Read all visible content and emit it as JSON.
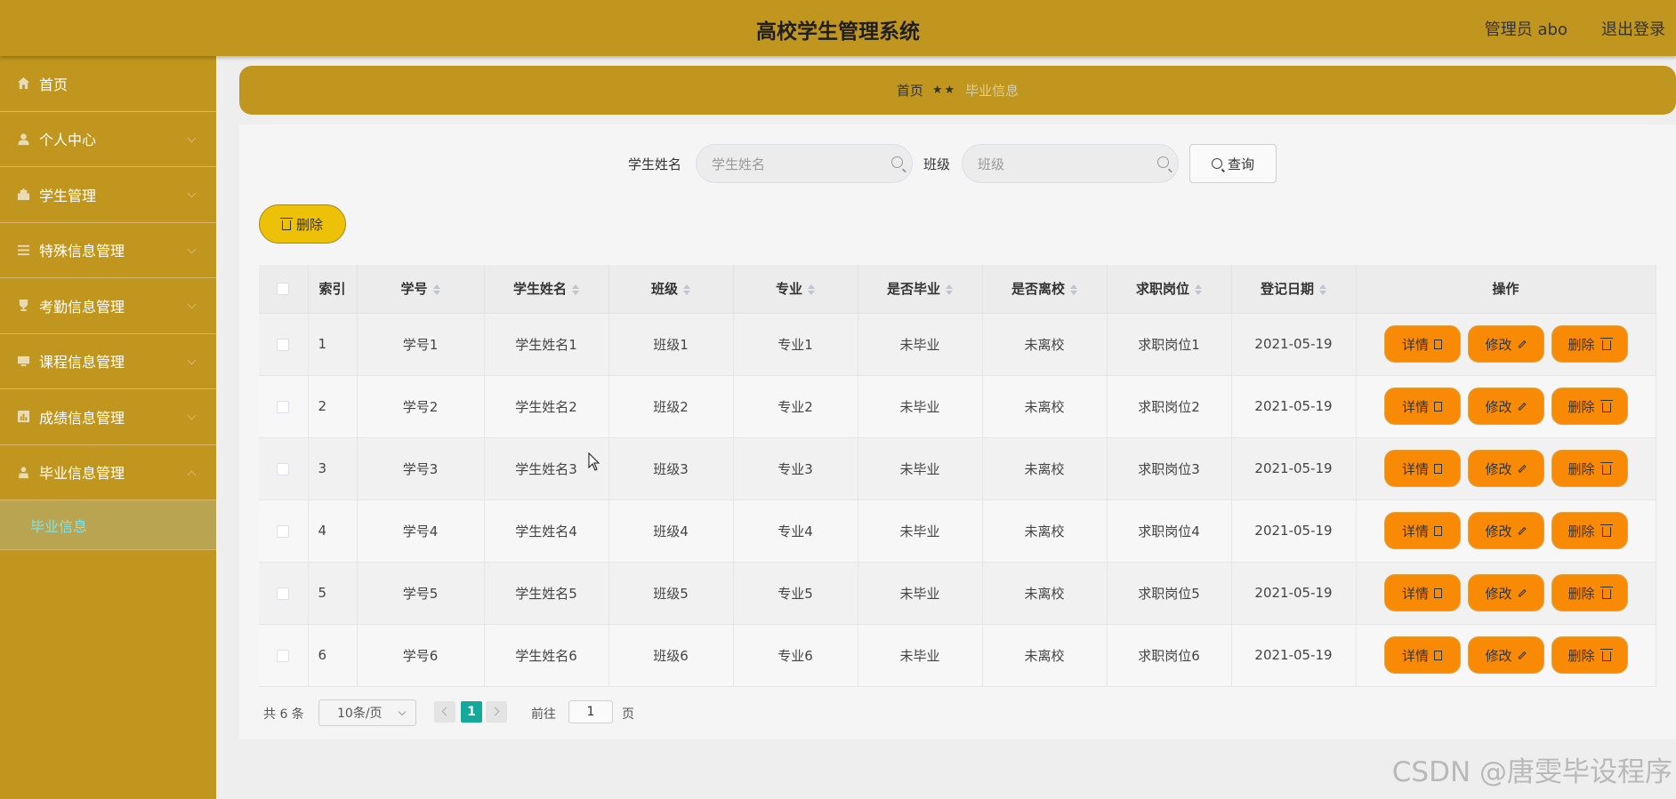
{
  "header": {
    "title": "高校学生管理系统",
    "admin": "管理员 abo",
    "logout": "退出登录"
  },
  "sidebar": {
    "items": [
      {
        "label": "首页",
        "icon": "home-icon",
        "has_arrow": false
      },
      {
        "label": "个人中心",
        "icon": "user-icon",
        "has_arrow": true
      },
      {
        "label": "学生管理",
        "icon": "student-icon",
        "has_arrow": true
      },
      {
        "label": "特殊信息管理",
        "icon": "list-icon",
        "has_arrow": true
      },
      {
        "label": "考勤信息管理",
        "icon": "trophy-icon",
        "has_arrow": true
      },
      {
        "label": "课程信息管理",
        "icon": "monitor-icon",
        "has_arrow": true
      },
      {
        "label": "成绩信息管理",
        "icon": "chart-icon",
        "has_arrow": true
      },
      {
        "label": "毕业信息管理",
        "icon": "person-icon",
        "has_arrow": true
      }
    ],
    "subitem": "毕业信息"
  },
  "breadcrumb": {
    "home": "首页",
    "separator": "★★",
    "current": "毕业信息"
  },
  "search": {
    "name_label": "学生姓名",
    "name_placeholder": "学生姓名",
    "class_label": "班级",
    "class_placeholder": "班级",
    "query_button": "查询"
  },
  "delete_button": "删除",
  "table": {
    "headers": [
      "索引",
      "学号",
      "学生姓名",
      "班级",
      "专业",
      "是否毕业",
      "是否离校",
      "求职岗位",
      "登记日期",
      "操作"
    ],
    "rows": [
      {
        "index": "1",
        "student_no": "学号1",
        "name": "学生姓名1",
        "class": "班级1",
        "major": "专业1",
        "graduated": "未毕业",
        "left_school": "未离校",
        "job": "求职岗位1",
        "date": "2021-05-19"
      },
      {
        "index": "2",
        "student_no": "学号2",
        "name": "学生姓名2",
        "class": "班级2",
        "major": "专业2",
        "graduated": "未毕业",
        "left_school": "未离校",
        "job": "求职岗位2",
        "date": "2021-05-19"
      },
      {
        "index": "3",
        "student_no": "学号3",
        "name": "学生姓名3",
        "class": "班级3",
        "major": "专业3",
        "graduated": "未毕业",
        "left_school": "未离校",
        "job": "求职岗位3",
        "date": "2021-05-19"
      },
      {
        "index": "4",
        "student_no": "学号4",
        "name": "学生姓名4",
        "class": "班级4",
        "major": "专业4",
        "graduated": "未毕业",
        "left_school": "未离校",
        "job": "求职岗位4",
        "date": "2021-05-19"
      },
      {
        "index": "5",
        "student_no": "学号5",
        "name": "学生姓名5",
        "class": "班级5",
        "major": "专业5",
        "graduated": "未毕业",
        "left_school": "未离校",
        "job": "求职岗位5",
        "date": "2021-05-19"
      },
      {
        "index": "6",
        "student_no": "学号6",
        "name": "学生姓名6",
        "class": "班级6",
        "major": "专业6",
        "graduated": "未毕业",
        "left_school": "未离校",
        "job": "求职岗位6",
        "date": "2021-05-19"
      }
    ],
    "actions": {
      "detail": "详情",
      "edit": "修改",
      "delete": "删除"
    }
  },
  "pagination": {
    "total": "共 6 条",
    "page_size": "10条/页",
    "current_page": "1",
    "goto_label": "前往",
    "goto_value": "1",
    "page_suffix": "页"
  },
  "watermark": "CSDN @唐雯毕设程序",
  "colors": {
    "primary": "#c0961f",
    "action_button": "#f98a06",
    "delete_button": "#ecc107",
    "active_page": "#15a99a",
    "active_submenu_text": "#7fe3e8"
  }
}
